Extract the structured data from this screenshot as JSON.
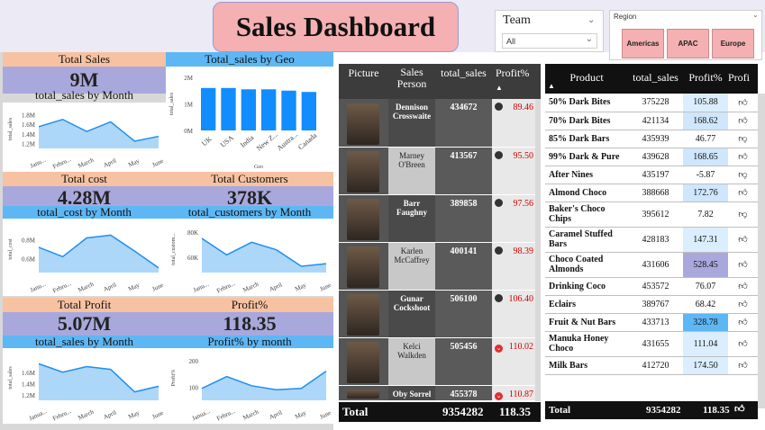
{
  "title": "Sales Dashboard",
  "team_slicer": {
    "title": "Team",
    "value": "All"
  },
  "region_slicer": {
    "title": "Region",
    "buttons": [
      "Americas",
      "APAC",
      "Europe"
    ]
  },
  "kpis": {
    "total_sales": {
      "label": "Total Sales",
      "value": "9M"
    },
    "total_cost": {
      "label": "Total cost",
      "value": "4.28M"
    },
    "total_customers": {
      "label": "Total Customers",
      "value": "378K"
    },
    "total_profit": {
      "label": "Total Profit",
      "value": "5.07M"
    },
    "profit_pct": {
      "label": "Profit%",
      "value": "118.35"
    }
  },
  "chart_data": [
    {
      "type": "area",
      "title": "total_sales by Month",
      "ylabel": "total_sales",
      "categories": [
        "January",
        "February",
        "March",
        "April",
        "May",
        "June"
      ],
      "tick_labels": [
        "Janu...",
        "Febru...",
        "March",
        "April",
        "May",
        "June"
      ],
      "values": [
        1.55,
        1.7,
        1.45,
        1.65,
        1.25,
        1.35
      ],
      "yticks": [
        "1.8M",
        "1.6M",
        "1.4M",
        "1.2M"
      ],
      "ylim": [
        1.1,
        1.9
      ],
      "grid": false
    },
    {
      "type": "bar",
      "title": "Total_sales by Geo",
      "xlabel": "Geo",
      "ylabel": "total_sales",
      "categories": [
        "UK",
        "USA",
        "India",
        "New Z...",
        "Austra...",
        "Canada"
      ],
      "values": [
        1.6,
        1.6,
        1.55,
        1.55,
        1.5,
        1.45
      ],
      "yticks": [
        "2M",
        "1M",
        "0M"
      ],
      "ylim": [
        0,
        2
      ],
      "color": "#118dff"
    },
    {
      "type": "area",
      "title": "total_cost by Month",
      "ylabel": "total_cost",
      "categories": [
        "January",
        "February",
        "March",
        "April",
        "May",
        "June"
      ],
      "tick_labels": [
        "Janu...",
        "Febru...",
        "March",
        "April",
        "May",
        "June"
      ],
      "values": [
        0.72,
        0.62,
        0.82,
        0.85,
        0.68,
        0.5
      ],
      "yticks": [
        "0.8M",
        "0.6M"
      ],
      "ylim": [
        0.45,
        0.95
      ]
    },
    {
      "type": "area",
      "title": "total_customers by Month",
      "ylabel": "total_custom...",
      "categories": [
        "January",
        "February",
        "March",
        "April",
        "May",
        "June"
      ],
      "tick_labels": [
        "Janu...",
        "Febru...",
        "March",
        "April",
        "May",
        "June"
      ],
      "values": [
        75,
        62,
        72,
        66,
        53,
        55
      ],
      "yticks": [
        "80K",
        "60K"
      ],
      "ylim": [
        48,
        85
      ]
    },
    {
      "type": "area",
      "title": "total_sales by Month",
      "ylabel": "total_sales",
      "categories": [
        "January",
        "February",
        "March",
        "April",
        "May",
        "June"
      ],
      "tick_labels": [
        "Janua...",
        "Febru...",
        "March",
        "April",
        "May",
        "June"
      ],
      "values": [
        1.75,
        1.6,
        1.7,
        1.65,
        1.25,
        1.35
      ],
      "yticks": [
        "1.6M",
        "1.4M",
        "1.2M"
      ],
      "ylim": [
        1.1,
        1.9
      ]
    },
    {
      "type": "area",
      "title": "Profit% by month",
      "ylabel": "Profit%",
      "categories": [
        "January",
        "February",
        "March",
        "April",
        "May",
        "June"
      ],
      "tick_labels": [
        "Janua...",
        "Febru...",
        "March",
        "April",
        "May",
        "June"
      ],
      "values": [
        95,
        140,
        105,
        90,
        95,
        160
      ],
      "yticks": [
        "200",
        "100"
      ],
      "ylim": [
        50,
        220
      ]
    }
  ],
  "salesperson_table": {
    "headers": [
      "Picture",
      "Sales Person",
      "total_sales",
      "Profit%"
    ],
    "rows": [
      {
        "name": "Dennison Crosswaite",
        "sales": "434672",
        "profit": "89.46",
        "flag": "dot"
      },
      {
        "name": "Marney O'Breen",
        "sales": "413567",
        "profit": "95.50",
        "flag": "dot"
      },
      {
        "name": "Barr Faughny",
        "sales": "389858",
        "profit": "97.56",
        "flag": "dot"
      },
      {
        "name": "Karlen McCaffrey",
        "sales": "400141",
        "profit": "98.39",
        "flag": "dot"
      },
      {
        "name": "Gunar Cockshoot",
        "sales": "506100",
        "profit": "106.40",
        "flag": "dot"
      },
      {
        "name": "Kelci Walkden",
        "sales": "505456",
        "profit": "110.02",
        "flag": "down"
      },
      {
        "name": "Oby Sorrel",
        "sales": "455378",
        "profit": "110.87",
        "flag": "down"
      }
    ],
    "total": {
      "label": "Total",
      "sales": "9354282",
      "profit": "118.35"
    }
  },
  "product_table": {
    "headers": [
      "Product",
      "total_sales",
      "Profit%",
      "Profi"
    ],
    "rows": [
      {
        "name": "50% Dark Bites",
        "sales": "375228",
        "profit": "105.88",
        "icon": "thumbs-up",
        "tint": "#dbeeff"
      },
      {
        "name": "70% Dark Bites",
        "sales": "421134",
        "profit": "168.62",
        "icon": "thumbs-up",
        "tint": "#cfe6fd"
      },
      {
        "name": "85% Dark Bars",
        "sales": "435939",
        "profit": "46.77",
        "icon": "thumbs-down",
        "tint": "#ffffff"
      },
      {
        "name": "99% Dark & Pure",
        "sales": "439628",
        "profit": "168.65",
        "icon": "thumbs-up",
        "tint": "#cfe6fd"
      },
      {
        "name": "After Nines",
        "sales": "435197",
        "profit": "-5.87",
        "icon": "thumbs-down",
        "tint": "#ffffff"
      },
      {
        "name": "Almond Choco",
        "sales": "388668",
        "profit": "172.76",
        "icon": "thumbs-up",
        "tint": "#cfe6fd"
      },
      {
        "name": "Baker's Choco Chips",
        "sales": "395612",
        "profit": "7.82",
        "icon": "thumbs-down",
        "tint": "#ffffff"
      },
      {
        "name": "Caramel Stuffed Bars",
        "sales": "428183",
        "profit": "147.31",
        "icon": "thumbs-up",
        "tint": "#dbeeff"
      },
      {
        "name": "Choco Coated Almonds",
        "sales": "431606",
        "profit": "528.45",
        "icon": "thumbs-up",
        "tint": "#a9a8dc"
      },
      {
        "name": "Drinking Coco",
        "sales": "453572",
        "profit": "76.07",
        "icon": "thumbs-up",
        "tint": "#ffffff"
      },
      {
        "name": "Eclairs",
        "sales": "389767",
        "profit": "68.42",
        "icon": "thumbs-up",
        "tint": "#ffffff"
      },
      {
        "name": "Fruit & Nut Bars",
        "sales": "433713",
        "profit": "328.78",
        "icon": "thumbs-up",
        "tint": "#5db7f5"
      },
      {
        "name": "Manuka Honey Choco",
        "sales": "431655",
        "profit": "111.04",
        "icon": "thumbs-up",
        "tint": "#dbeeff"
      },
      {
        "name": "Milk Bars",
        "sales": "412720",
        "profit": "174.50",
        "icon": "thumbs-up",
        "tint": "#dbeeff"
      }
    ],
    "total": {
      "label": "Total",
      "sales": "9354282",
      "profit": "118.35"
    }
  }
}
